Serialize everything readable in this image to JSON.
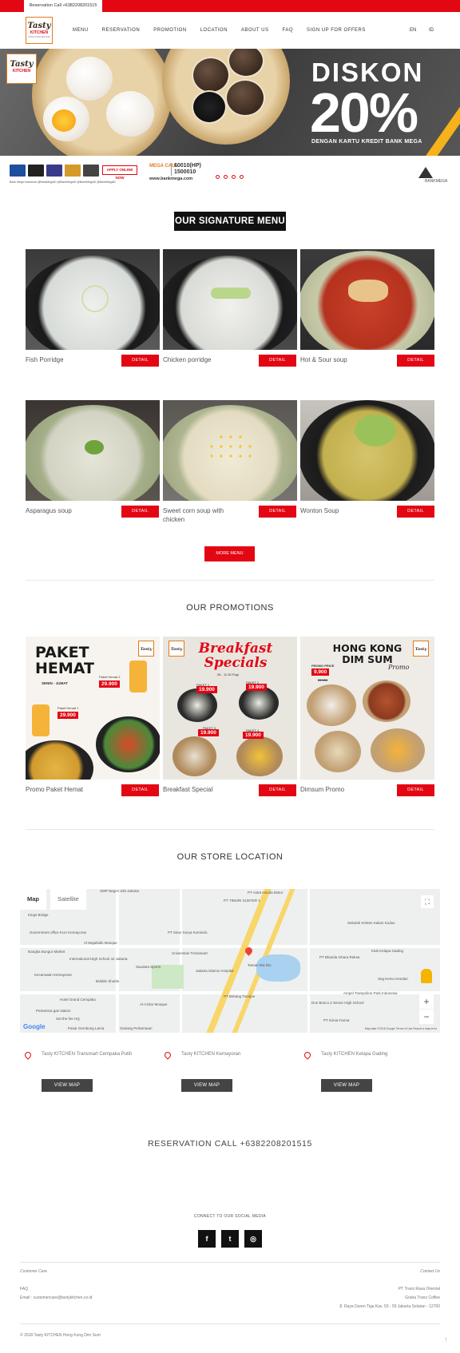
{
  "topbar": {
    "reservation": "Reservation Call +6382208201515"
  },
  "brand": {
    "name": "Tasty",
    "sub": "KITCHEN",
    "tagline": "HONG KONG DIM SUM"
  },
  "nav": {
    "items": [
      "MENU",
      "RESERVATION",
      "PROMOTION",
      "LOCATION",
      "ABOUT US",
      "FAQ",
      "SIGN UP FOR OFFERS"
    ],
    "lang": [
      "EN",
      "ID"
    ]
  },
  "hero": {
    "headline": "DISKON",
    "percent": "20%",
    "subline": "DENGAN KARTU KREDIT BANK MEGA",
    "apply": "APPLY ONLINE NOW",
    "social_links": "Bank Mega Indonesia  @BankMegaID  @BankMegaID  @BankMegaID  @BankMegaID",
    "mega_label": "MEGA CALL",
    "mega_phone_1": "60010(HP)",
    "mega_phone_2": "1500010",
    "website": "www.bankmega.com",
    "bank_logo": "BANKMEGA",
    "slides": 4
  },
  "signature": {
    "title": "OUR SIGNATURE MENU",
    "detail_label": "DETAIL",
    "more_label": "MORE MENU",
    "items": [
      {
        "name": "Fish Porridge"
      },
      {
        "name": "Chicken porridge"
      },
      {
        "name": "Hot & Sour soup"
      },
      {
        "name": "Asparagus soup"
      },
      {
        "name": "Sweet corn soup with chicken"
      },
      {
        "name": "Wonton Soup"
      }
    ]
  },
  "promotions": {
    "title": "OUR PROMOTIONS",
    "detail_label": "DETAIL",
    "items": [
      {
        "name": "Promo Paket Hemat",
        "poster_title": "PAKET HEMAT",
        "poster_sub": "SENIN - JUMAT",
        "price_1": "29.900",
        "price_2": "29.900",
        "label_1": "Paket Hemat 2",
        "label_2": "Paket Hemat 1"
      },
      {
        "name": "Breakfast Special",
        "poster_title": "Breakfast Specials",
        "poster_sub": "06 - 11.30 Pagi",
        "price_1": "19.900",
        "price_2": "19.900",
        "price_3": "19.900",
        "price_4": "19.900",
        "label_1": "PAKET 1",
        "label_2": "PAKET 2",
        "label_3": "PAKET 3",
        "label_4": "PAKET 4"
      },
      {
        "name": "Dimsum Promo",
        "poster_title": "HONG KONG DIM SUM",
        "poster_sub": "Promo",
        "price_1": "9.900",
        "price_old": "22.900",
        "label_1": "PROMO PRICE"
      }
    ]
  },
  "location": {
    "title": "OUR STORE LOCATION",
    "map": {
      "tabs": [
        "Map",
        "Satellite"
      ],
      "attribution": "Map data ©2018 Google   Terms of Use   Report a map error",
      "labels": [
        "SMP Negeri 228 Jakarta",
        "PT Astra Honda Motor",
        "PT TIMURI SUNTER 1",
        "Government office KUA Kemayoran",
        "Al Mujahidin Mosque",
        "Universitas Trisnamart",
        "Kings Bridge",
        "Nangka Bungur Market",
        "International High School 44 Jakarta",
        "Kecamatan Kemayoran",
        "Saudara Sports",
        "Jakarta Islamic Hospital",
        "Taman Ria Rio",
        "PT Bintang Toedjoe",
        "Bubble Shuttle",
        "Hotel Grand Cempaka",
        "Al-Azhar Mosque",
        "Pertamina gas station",
        "Set the fire HQ",
        "Gedung Perbentuan",
        "Klub Kelapa Gading",
        "Pasar Gembong Lama",
        "PT Bhanda Ghara Reksa",
        "Ampel Trampoline Park Indonesia",
        "Seg Kemo Kendari",
        "Don Bosco 2 Senior High School",
        "PT Kimia Farma",
        "Sekolah Kristen Kalam Kudus",
        "PT Sinar Surya Komindo"
      ]
    },
    "stores": [
      {
        "name": "Tasty KITCHEN Transmart Cempaka Putih"
      },
      {
        "name": "Tasty KITCHEN Kemayoran"
      },
      {
        "name": "Tasty KITCHEN Kelapa Gading"
      }
    ],
    "view_label": "VIEW MAP"
  },
  "reservation": "RESERVATION CALL +6382208201515",
  "social": {
    "connect": "CONNECT TO OUR SOCIAL MEDIA",
    "icons": [
      "f",
      "t",
      "◎"
    ]
  },
  "footer": {
    "customer_care": "Customer Care",
    "contact_us": "Contact Us",
    "faq": "FAQ",
    "email": "Email : customercare@tastykitchen.co.id",
    "company": "PT Trans Rasa Oriental",
    "building": "Graha Trans Coffee",
    "address": "Jl. Raya Duren Tiga Kav. 53 - 55 Jakarta Selatan - 12760",
    "copyright": "© 2018 Tasty KITCHEN Hong Kong Dim Sum",
    "scroll_top": "↑"
  },
  "colors": {
    "accent": "#e30613",
    "dark": "#111111",
    "button_gray": "#444444",
    "brand_orange": "#e07b1a"
  }
}
